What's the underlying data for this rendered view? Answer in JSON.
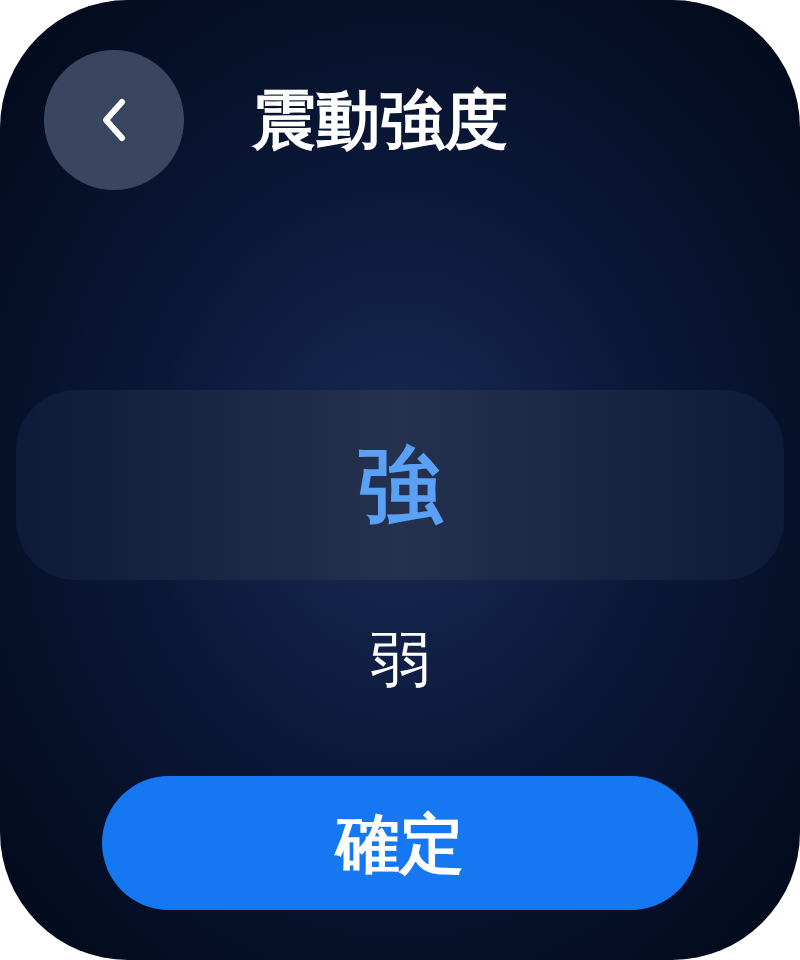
{
  "header": {
    "title": "震動強度"
  },
  "picker": {
    "options": [
      {
        "label": "強",
        "selected": true
      },
      {
        "label": "弱",
        "selected": false
      }
    ]
  },
  "confirm_button": {
    "label": "確定"
  }
}
